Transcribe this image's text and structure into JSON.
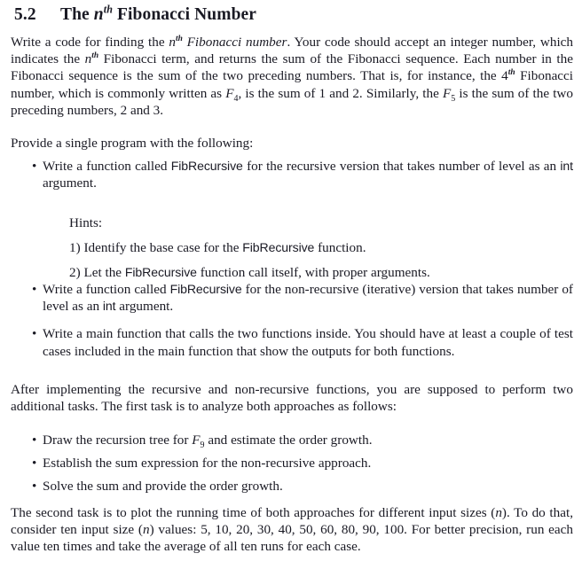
{
  "document": {
    "heading": {
      "number": "5.2",
      "title_pre": "The ",
      "title_n": "n",
      "title_sup": "th",
      "title_post": " Fibonacci Number"
    },
    "intro_paragraph": {
      "seg1": "Write a code for finding the ",
      "n1": "n",
      "sup1": "th",
      "italic_phrase": " Fibonacci number",
      "seg2": ". Your code should accept an integer number, which indicates the ",
      "n2": "n",
      "sup2": "th",
      "seg3": " Fibonacci term, and returns the sum of the Fibonacci sequence. Each number in the Fibonacci sequence is the sum of the two preceding numbers. That is, for instance, the 4",
      "sup3": "th",
      "seg4": " Fibonacci number, which is commonly written as ",
      "F4": "F",
      "sub4": "4",
      "seg5": ", is the sum of 1 and 2. Similarly, the ",
      "F5": "F",
      "sub5": "5",
      "seg6": " is the sum of the two preceding numbers, 2 and 3."
    },
    "provide_line": "Provide a single program with the following:",
    "bullets_group1": [
      {
        "marker": "•",
        "seg1": "Write a function called ",
        "code1": "FibRecursive",
        "seg2": " for the recursive version that takes number of level as an ",
        "code2": "int",
        "seg3": " argument."
      }
    ],
    "hints": {
      "label": "Hints:",
      "items": [
        {
          "marker": "1)",
          "seg1": " Identify the base case for the ",
          "code": "FibRecursive",
          "seg2": " function."
        },
        {
          "marker": "2)",
          "seg1": " Let the ",
          "code": "FibRecursive",
          "seg2": " function call itself, with proper arguments."
        }
      ]
    },
    "bullets_group2": [
      {
        "marker": "•",
        "seg1": "Write a function called ",
        "code1": "FibRecursive",
        "seg2": " for the non-recursive (iterative) version that takes number of level as an ",
        "code2": "int",
        "seg3": " argument."
      },
      {
        "marker": "•",
        "text": "Write a main function that calls the two functions inside.  You should have at least a couple of test cases included in the main function that show the outputs for both functions."
      }
    ],
    "after_paragraph": "After implementing the recursive and non-recursive functions, you are supposed to perform two additional tasks.  The first task is to analyze both approaches as follows:",
    "bullets_group3": [
      {
        "marker": "•",
        "seg1": "Draw the recursion tree for ",
        "F": "F",
        "sub": "9",
        "seg2": " and estimate the order growth."
      },
      {
        "marker": "•",
        "text": "Establish the sum expression for the non-recursive approach."
      },
      {
        "marker": "•",
        "text": "Solve the sum and provide the order growth."
      }
    ],
    "final_paragraph": {
      "seg1": "The second task is to plot the running time of both approaches for different input sizes (",
      "n1": "n",
      "seg2": "). To do that, consider ten input size (",
      "n2": "n",
      "seg3": ") values:  5, 10, 20, 30, 40, 50, 60, 80, 90, 100.  For better precision, run each value ten times and take the average of all ten runs for each case."
    }
  }
}
